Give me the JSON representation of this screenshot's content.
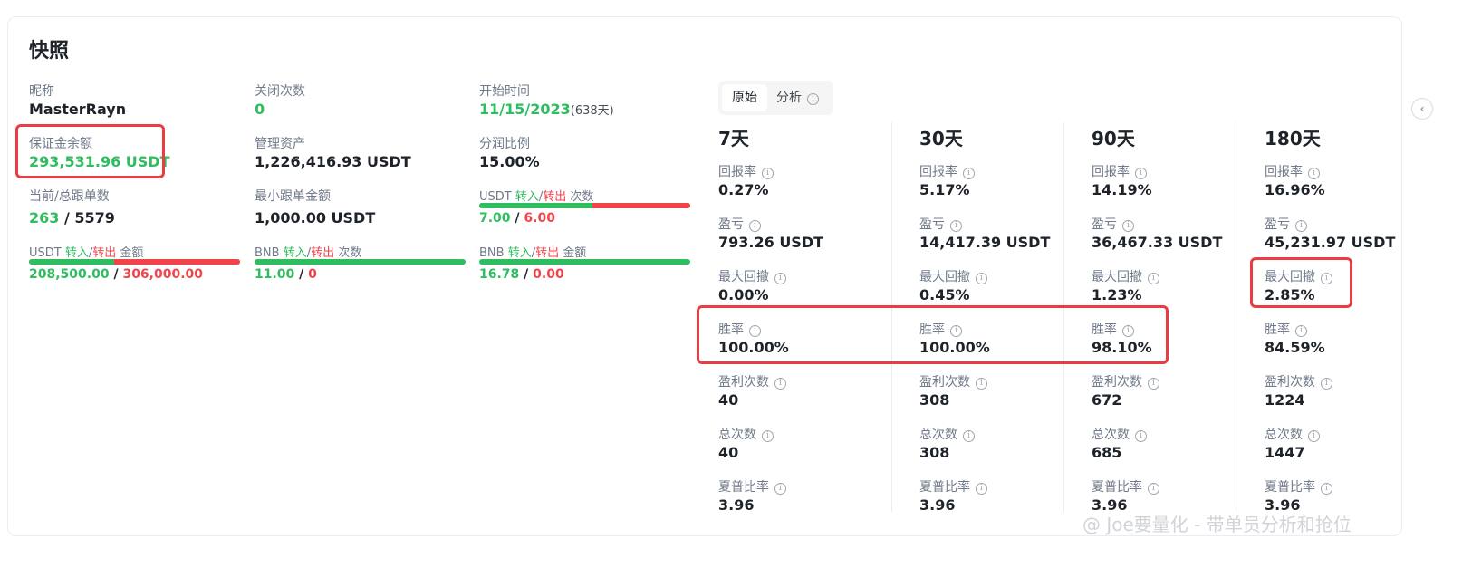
{
  "title": "快照",
  "profile": {
    "nickname_label": "昵称",
    "nickname": "MasterRayn",
    "margin_label": "保证金余额",
    "margin_value": "293,531.96 USDT",
    "copiers_label": "当前/总跟单数",
    "copiers_current": "263",
    "copiers_total": "5579",
    "closed_label": "关闭次数",
    "closed_value": "0",
    "aum_label": "管理资产",
    "aum_value": "1,226,416.93 USDT",
    "min_copy_label": "最小跟单金额",
    "min_copy_value": "1,000.00 USDT",
    "start_label": "开始时间",
    "start_date": "11/15/2023",
    "start_days": "(638天)",
    "profit_share_label": "分润比例",
    "profit_share_value": "15.00%"
  },
  "flows": [
    {
      "asset": "USDT",
      "in": "转入",
      "slash": "/",
      "out": "转出",
      "kind": "金额",
      "in_value": "208,500.00",
      "out_value": "306,000.00",
      "in_fraction": 0.405
    },
    {
      "asset": "BNB",
      "in": "转入",
      "slash": "/",
      "out": "转出",
      "kind": "次数",
      "in_value": "11.00",
      "out_value": "0",
      "in_fraction": 1.0
    },
    {
      "asset": "BNB",
      "in": "转入",
      "slash": "/",
      "out": "转出",
      "kind": "金额",
      "in_value": "16.78",
      "out_value": "0.00",
      "in_fraction": 1.0
    },
    {
      "asset": "USDT",
      "in": "转入",
      "slash": "/",
      "out": "转出",
      "kind": "次数",
      "in_value": "7.00",
      "out_value": "6.00",
      "in_fraction": 0.538
    }
  ],
  "tabs": {
    "raw": "原始",
    "analysis": "分析"
  },
  "info_glyph": "i",
  "separator": "/",
  "metric_labels": {
    "roi": "回报率",
    "pnl": "盈亏",
    "mdd": "最大回撤",
    "winrate": "胜率",
    "wins": "盈利次数",
    "total": "总次数",
    "sharpe": "夏普比率"
  },
  "periods": [
    {
      "name": "7天",
      "roi": "0.27%",
      "pnl": "793.26 USDT",
      "mdd": "0.00%",
      "winrate": "100.00%",
      "wins": "40",
      "total": "40",
      "sharpe": "3.96"
    },
    {
      "name": "30天",
      "roi": "5.17%",
      "pnl": "14,417.39 USDT",
      "mdd": "0.45%",
      "winrate": "100.00%",
      "wins": "308",
      "total": "308",
      "sharpe": "3.96"
    },
    {
      "name": "90天",
      "roi": "14.19%",
      "pnl": "36,467.33 USDT",
      "mdd": "1.23%",
      "winrate": "98.10%",
      "wins": "672",
      "total": "685",
      "sharpe": "3.96"
    },
    {
      "name": "180天",
      "roi": "16.96%",
      "pnl": "45,231.97 USDT",
      "mdd": "2.85%",
      "winrate": "84.59%",
      "wins": "1224",
      "total": "1447",
      "sharpe": "3.96"
    }
  ],
  "winrate_colors": [
    "red",
    "red",
    "red",
    "dark"
  ],
  "watermark": "@ Joe要量化 - 带单员分析和抢位",
  "edge_button": "‹",
  "colors": {
    "green": "#2ebd5f",
    "red": "#f0434a",
    "highlight": "#e83d42",
    "text": "#1e2329",
    "muted": "#707a8a"
  }
}
